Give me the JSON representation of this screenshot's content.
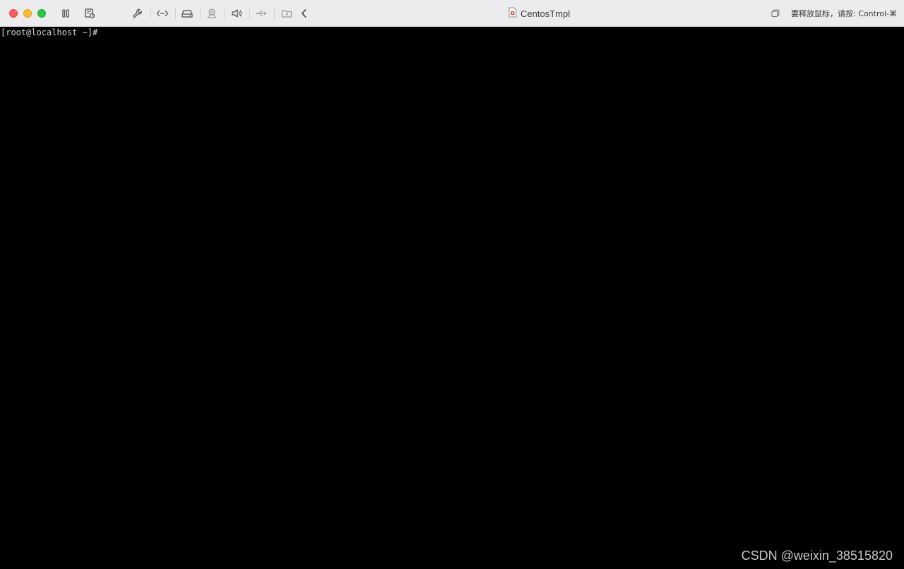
{
  "window": {
    "title": "CentosTmpl",
    "hint": "要释放鼠标，请按: Control-⌘"
  },
  "toolbar": {
    "icons": [
      "pause-icon",
      "snapshot-icon",
      "settings-wrench-icon",
      "network-icon",
      "disk-icon",
      "camera-icon",
      "sound-icon",
      "usb-icon",
      "shared-folder-icon",
      "chevron-left-icon"
    ]
  },
  "terminal": {
    "prompt": "[root@localhost ~]#"
  },
  "watermark": {
    "text": "CSDN @weixin_38515820"
  },
  "colors": {
    "titlebar_bg": "#ecebed",
    "terminal_bg": "#000000",
    "terminal_fg": "#d8d8d8",
    "close": "#fe5f57",
    "minimize": "#febc2e",
    "maximize": "#28c840"
  }
}
